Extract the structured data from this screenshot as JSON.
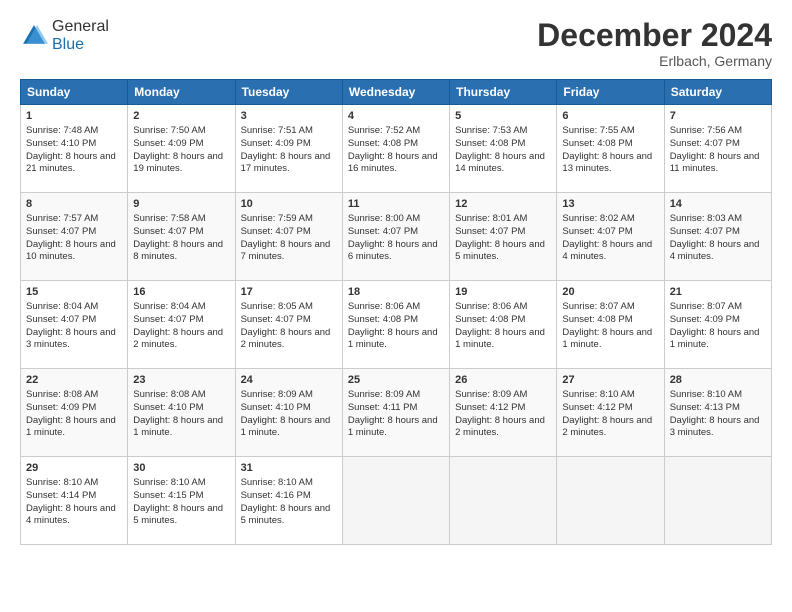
{
  "logo": {
    "general": "General",
    "blue": "Blue"
  },
  "header": {
    "month": "December 2024",
    "location": "Erlbach, Germany"
  },
  "days": [
    "Sunday",
    "Monday",
    "Tuesday",
    "Wednesday",
    "Thursday",
    "Friday",
    "Saturday"
  ],
  "weeks": [
    [
      {
        "num": "1",
        "sunrise": "7:48 AM",
        "sunset": "4:10 PM",
        "daylight": "8 hours and 21 minutes."
      },
      {
        "num": "2",
        "sunrise": "7:50 AM",
        "sunset": "4:09 PM",
        "daylight": "8 hours and 19 minutes."
      },
      {
        "num": "3",
        "sunrise": "7:51 AM",
        "sunset": "4:09 PM",
        "daylight": "8 hours and 17 minutes."
      },
      {
        "num": "4",
        "sunrise": "7:52 AM",
        "sunset": "4:08 PM",
        "daylight": "8 hours and 16 minutes."
      },
      {
        "num": "5",
        "sunrise": "7:53 AM",
        "sunset": "4:08 PM",
        "daylight": "8 hours and 14 minutes."
      },
      {
        "num": "6",
        "sunrise": "7:55 AM",
        "sunset": "4:08 PM",
        "daylight": "8 hours and 13 minutes."
      },
      {
        "num": "7",
        "sunrise": "7:56 AM",
        "sunset": "4:07 PM",
        "daylight": "8 hours and 11 minutes."
      }
    ],
    [
      {
        "num": "8",
        "sunrise": "7:57 AM",
        "sunset": "4:07 PM",
        "daylight": "8 hours and 10 minutes."
      },
      {
        "num": "9",
        "sunrise": "7:58 AM",
        "sunset": "4:07 PM",
        "daylight": "8 hours and 8 minutes."
      },
      {
        "num": "10",
        "sunrise": "7:59 AM",
        "sunset": "4:07 PM",
        "daylight": "8 hours and 7 minutes."
      },
      {
        "num": "11",
        "sunrise": "8:00 AM",
        "sunset": "4:07 PM",
        "daylight": "8 hours and 6 minutes."
      },
      {
        "num": "12",
        "sunrise": "8:01 AM",
        "sunset": "4:07 PM",
        "daylight": "8 hours and 5 minutes."
      },
      {
        "num": "13",
        "sunrise": "8:02 AM",
        "sunset": "4:07 PM",
        "daylight": "8 hours and 4 minutes."
      },
      {
        "num": "14",
        "sunrise": "8:03 AM",
        "sunset": "4:07 PM",
        "daylight": "8 hours and 4 minutes."
      }
    ],
    [
      {
        "num": "15",
        "sunrise": "8:04 AM",
        "sunset": "4:07 PM",
        "daylight": "8 hours and 3 minutes."
      },
      {
        "num": "16",
        "sunrise": "8:04 AM",
        "sunset": "4:07 PM",
        "daylight": "8 hours and 2 minutes."
      },
      {
        "num": "17",
        "sunrise": "8:05 AM",
        "sunset": "4:07 PM",
        "daylight": "8 hours and 2 minutes."
      },
      {
        "num": "18",
        "sunrise": "8:06 AM",
        "sunset": "4:08 PM",
        "daylight": "8 hours and 1 minute."
      },
      {
        "num": "19",
        "sunrise": "8:06 AM",
        "sunset": "4:08 PM",
        "daylight": "8 hours and 1 minute."
      },
      {
        "num": "20",
        "sunrise": "8:07 AM",
        "sunset": "4:08 PM",
        "daylight": "8 hours and 1 minute."
      },
      {
        "num": "21",
        "sunrise": "8:07 AM",
        "sunset": "4:09 PM",
        "daylight": "8 hours and 1 minute."
      }
    ],
    [
      {
        "num": "22",
        "sunrise": "8:08 AM",
        "sunset": "4:09 PM",
        "daylight": "8 hours and 1 minute."
      },
      {
        "num": "23",
        "sunrise": "8:08 AM",
        "sunset": "4:10 PM",
        "daylight": "8 hours and 1 minute."
      },
      {
        "num": "24",
        "sunrise": "8:09 AM",
        "sunset": "4:10 PM",
        "daylight": "8 hours and 1 minute."
      },
      {
        "num": "25",
        "sunrise": "8:09 AM",
        "sunset": "4:11 PM",
        "daylight": "8 hours and 1 minute."
      },
      {
        "num": "26",
        "sunrise": "8:09 AM",
        "sunset": "4:12 PM",
        "daylight": "8 hours and 2 minutes."
      },
      {
        "num": "27",
        "sunrise": "8:10 AM",
        "sunset": "4:12 PM",
        "daylight": "8 hours and 2 minutes."
      },
      {
        "num": "28",
        "sunrise": "8:10 AM",
        "sunset": "4:13 PM",
        "daylight": "8 hours and 3 minutes."
      }
    ],
    [
      {
        "num": "29",
        "sunrise": "8:10 AM",
        "sunset": "4:14 PM",
        "daylight": "8 hours and 4 minutes."
      },
      {
        "num": "30",
        "sunrise": "8:10 AM",
        "sunset": "4:15 PM",
        "daylight": "8 hours and 5 minutes."
      },
      {
        "num": "31",
        "sunrise": "8:10 AM",
        "sunset": "4:16 PM",
        "daylight": "8 hours and 5 minutes."
      },
      null,
      null,
      null,
      null
    ]
  ],
  "labels": {
    "sunrise": "Sunrise:",
    "sunset": "Sunset:",
    "daylight": "Daylight:"
  }
}
